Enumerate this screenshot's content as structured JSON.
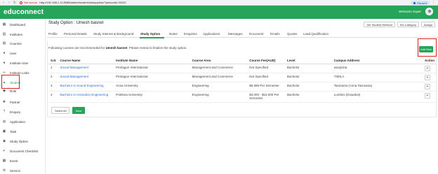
{
  "browser": {
    "security": "Not secure",
    "url": "http://192.168.1.11:8085/admin/student/studyoption/?personId=20102",
    "profile": "Paused"
  },
  "app": {
    "logo": "educonnect",
    "welcome": "Welcome Super"
  },
  "sidebar": {
    "items": [
      {
        "label": "Dashboard",
        "icon": "dashboard-icon"
      },
      {
        "label": "Institutes",
        "icon": "building-icon"
      },
      {
        "label": "Courses",
        "icon": "book-icon"
      },
      {
        "label": "User",
        "icon": "user-icon"
      },
      {
        "label": "Institute User",
        "icon": "user-icon"
      },
      {
        "label": "Institute Links",
        "icon": "link-icon"
      },
      {
        "label": "Student",
        "icon": "graduation-cap-icon"
      },
      {
        "label": "Role",
        "icon": "role-icon"
      },
      {
        "label": "Partner",
        "icon": "handshake-icon"
      },
      {
        "label": "Enquiry",
        "icon": "question-icon"
      },
      {
        "label": "Application",
        "icon": "globe-icon"
      },
      {
        "label": "Task",
        "icon": "task-icon"
      },
      {
        "label": "Study Option",
        "icon": "study-option-icon"
      },
      {
        "label": "Document Checklist",
        "icon": "checklist-icon"
      },
      {
        "label": "Event",
        "icon": "calendar-icon"
      },
      {
        "label": "Service",
        "icon": "service-icon"
      }
    ]
  },
  "header": {
    "title": "Study Option : Umesh basnet",
    "buttons": [
      "Set Student Referral",
      "Set Category",
      "Assign"
    ]
  },
  "tabs": [
    "Profile",
    "Personal Details",
    "Study Interest & Background",
    "Study Option",
    "Notes",
    "Enquiries",
    "Applications",
    "Messages",
    "Document",
    "Emails",
    "Quotes",
    "Lead Qualification"
  ],
  "notice": {
    "before": "Following courses are recommended for",
    "name": "Umesh basnet",
    "after": ". Please review to finalize the study option."
  },
  "add_new_label": "Add New",
  "table": {
    "headers": [
      "S.N",
      "Course Name",
      "Institute Name",
      "Course Area",
      "Course Fee(AUD)",
      "Level",
      "Campus Address",
      "Action"
    ],
    "rows": [
      {
        "sn": "1",
        "course": "Sound Management",
        "institute": "Pentagon International",
        "area": "Management and Commerce",
        "fee": "Not Specified",
        "level": "Bachelor",
        "campus": "wasjscba"
      },
      {
        "sn": "2",
        "course": "Sound Management",
        "institute": "Pentagon International",
        "area": "Management and Commerce",
        "fee": "Not Specified",
        "level": "Bachelor",
        "campus": "TIMILA"
      },
      {
        "sn": "3",
        "course": "Bachelor in Sound Engineering",
        "institute": "Anna University",
        "area": "Engineering",
        "fee": "$6,989 Per Semester",
        "level": "Bachelor",
        "campus": "Tasmania (Anna Tasmania)"
      },
      {
        "sn": "4",
        "course": "Bachelor in Animation Engineering",
        "institute": "Pokhara University",
        "area": "Engineering",
        "fee": "$3,000 - $15,000 Per Semester",
        "level": "Bachelor",
        "campus": "Lumbini (Duwakot)"
      }
    ],
    "action_symbol": "+"
  },
  "footer": {
    "select_all": "Select All",
    "save": "Save"
  }
}
